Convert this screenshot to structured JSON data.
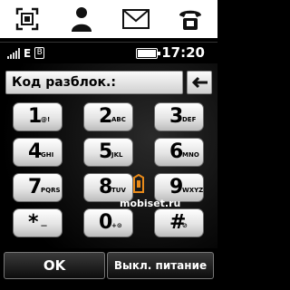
{
  "top_icons": [
    "contacts-grid-icon",
    "person-icon",
    "envelope-icon",
    "phone-icon"
  ],
  "status": {
    "network": "E",
    "bluetooth": "B",
    "time": "17:20",
    "battery_level": 1.0
  },
  "entry": {
    "label": "Код разблок.:"
  },
  "keys": [
    {
      "digit": "1",
      "letters": "@!"
    },
    {
      "digit": "2",
      "letters": "ABC"
    },
    {
      "digit": "3",
      "letters": "DEF"
    },
    {
      "digit": "4",
      "letters": "GHI"
    },
    {
      "digit": "5",
      "letters": "JKL"
    },
    {
      "digit": "6",
      "letters": "MNO"
    },
    {
      "digit": "7",
      "letters": "PQRS"
    },
    {
      "digit": "8",
      "letters": "TUV"
    },
    {
      "digit": "9",
      "letters": "WXYZ"
    },
    {
      "digit": "*",
      "letters": "—"
    },
    {
      "digit": "0",
      "letters": "+⊙"
    },
    {
      "digit": "#",
      "letters": "⊘"
    }
  ],
  "watermark": "mobiset.ru",
  "softkeys": {
    "ok": "OK",
    "power_off": "Выкл. питание"
  }
}
